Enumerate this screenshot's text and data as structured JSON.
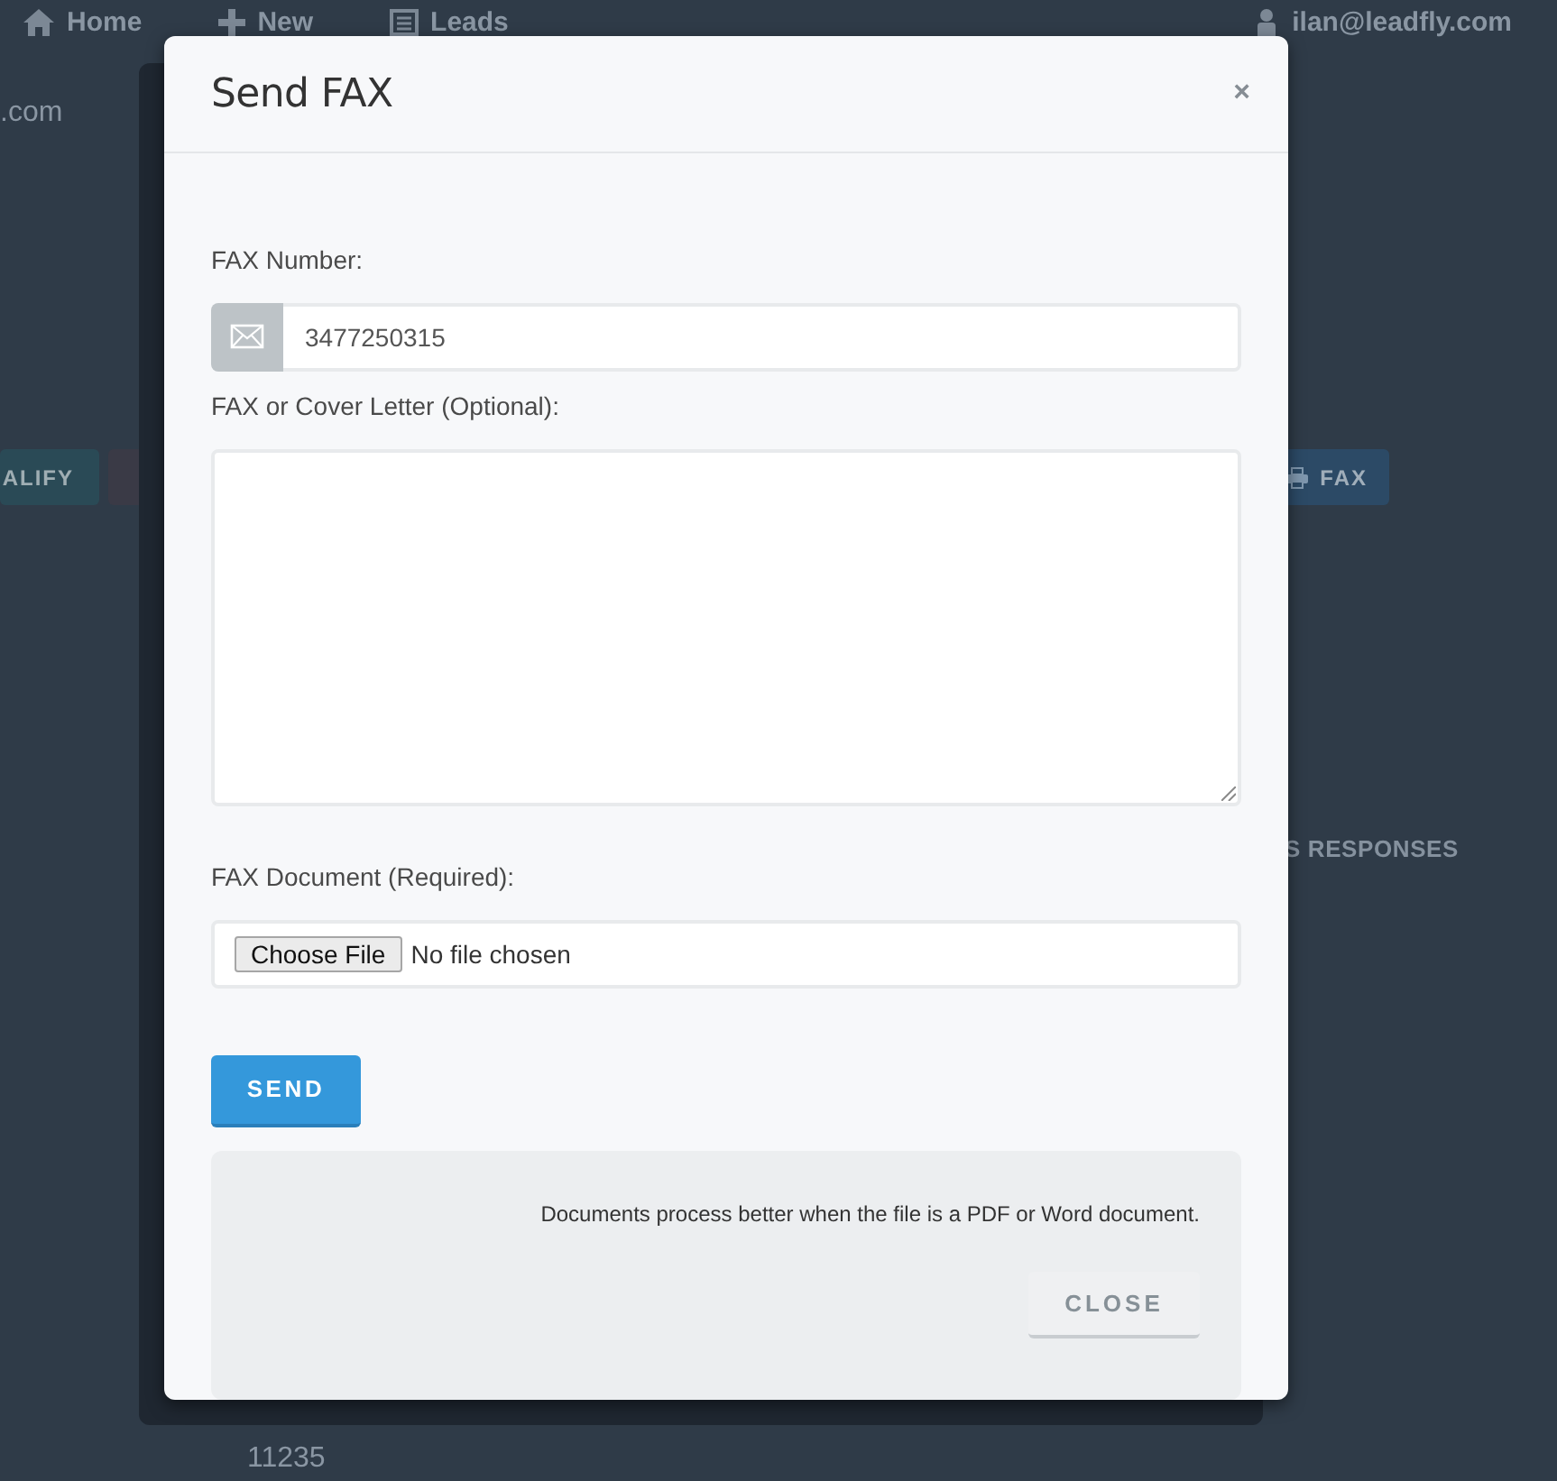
{
  "background_page": {
    "nav_items": [
      "Home",
      "New",
      "Leads"
    ],
    "user_email": "ilan@leadfly.com",
    "partial_text": ".com",
    "left_buttons": [
      {
        "label": "ALIFY",
        "color": "#2a4a56"
      },
      {
        "color": "#3a3a46"
      }
    ],
    "right_buttons": [
      {
        "label": "FAX",
        "color": "#2c4a66"
      }
    ],
    "section_heading": "S RESPONSES",
    "footer_text": "11235"
  },
  "modal": {
    "title": "Send FAX",
    "close": "×",
    "fields": [
      {
        "kind": "text",
        "label": "FAX Number:",
        "value": "3477250315"
      },
      {
        "kind": "textarea",
        "label": "FAX or Cover Letter (Optional):"
      },
      {
        "kind": "file",
        "label": "FAX Document (Required):",
        "button": "Choose File",
        "status": "No file chosen"
      }
    ],
    "send_button": "SEND",
    "footer": {
      "note": "Documents process better when the file is a PDF or Word document.",
      "close_button": "CLOSE"
    }
  }
}
